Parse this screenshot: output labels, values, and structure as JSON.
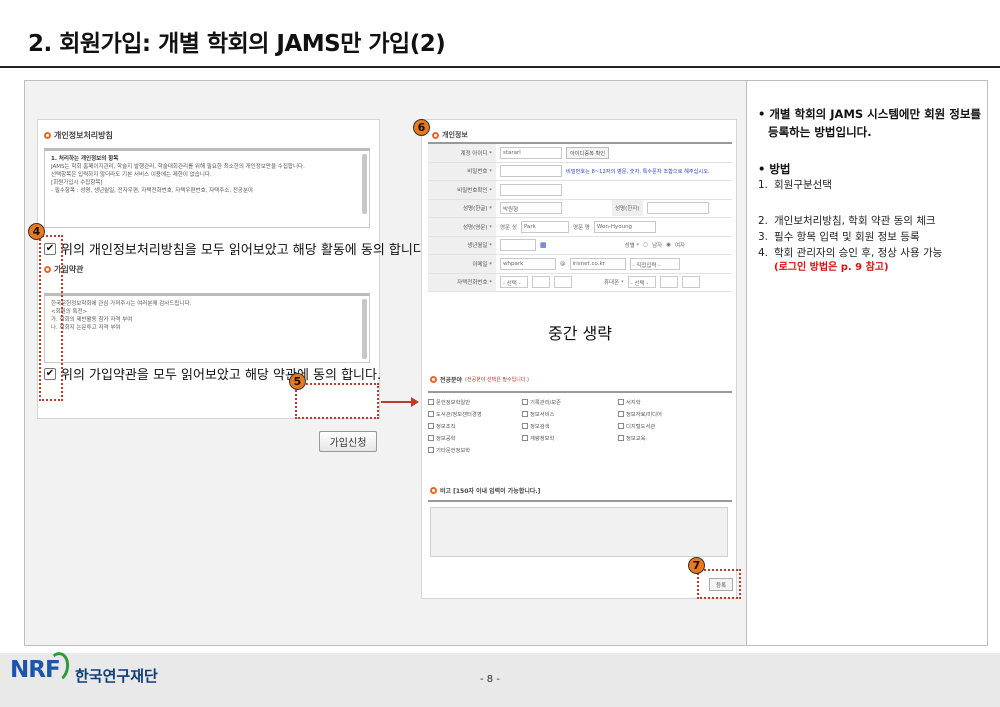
{
  "slide": {
    "title": "2. 회원가입: 개별 학회의 JAMS만 가입(2)",
    "page_number": "- 8 -"
  },
  "left_panel": {
    "privacy_heading": "개인정보처리방침",
    "privacy_text": [
      "1. 처리하는 개인정보의 항목",
      "JAMS는 학회 홈페이지관리, 학술지 발행관리, 학술대회관리를 위해 필요한 최소한의 개인정보만을 수집합니다.",
      "선택항목은 입력하지 않더라도 기본 서비스 이용에는 제한이 없습니다.",
      "",
      "[회원가입시 수집항목]",
      "- 필수항목 : 성명, 생년월일, 전자우편, 자택전화번호, 자택우편번호, 자택주소, 전공분야"
    ],
    "privacy_agree": "위의 개인정보처리방침을 모두 읽어보았고 해당 활동에 동의 합니다.",
    "terms_heading": "가입약관",
    "terms_text": [
      "한국문헌정보학회에 관심 가져주시는 여러분께 감사드립니다.",
      "",
      "<회원의 특전>",
      "가. 학회의 제반활동 참가 자격 부여",
      "나. 학회지 논문투고 자격 부여"
    ],
    "terms_agree": "위의 가입약관을 모두 읽어보았고 해당 약관에 동의 합니다.",
    "join_button": "가입신청"
  },
  "badges": {
    "b4": "4",
    "b5": "5",
    "b6": "6",
    "b7": "7"
  },
  "form": {
    "heading": "개인정보",
    "rows": {
      "account_id_label": "계정 아이디 *",
      "account_id_value": "stararl",
      "id_check_button": "아이디중복 확인",
      "password_label": "비밀번호 *",
      "password_note": "비밀번호는 8~12자의 영문, 숫자, 특수문자 조합으로 해주십시오.",
      "password_confirm_label": "비밀번호확인 *",
      "name_ko_label": "성명(한글) *",
      "name_ko_value": "박원형",
      "name_hanja_label": "성명(한자)",
      "name_en_label": "성명(영문) *",
      "name_en_last_label": "영문 성",
      "name_en_last_value": "Park",
      "name_en_first_label": "영문 명",
      "name_en_first_value": "Won-Hyoung",
      "birth_label": "생년월일 *",
      "gender_label": "성별 *",
      "gender_male": "남자",
      "gender_female": "여자",
      "email_label": "이메일 *",
      "email_id": "whpark",
      "email_at": "@",
      "email_domain": "irisnet.co.kr",
      "email_select": "- 직접입력 -",
      "home_phone_label": "자택전화번호 *",
      "home_phone_select": "- 선택 -",
      "mobile_label": "휴대폰 *",
      "mobile_select": "- 선택 -"
    },
    "omitted_text": "중간 생략",
    "field_heading": "전공분야",
    "field_sub": "(전공분야 선택은 필수입니다.)",
    "fields": [
      "문헌정보학일반",
      "기록관리/보존",
      "서지학",
      "도서관/정보센터경영",
      "정보서비스",
      "정보자료/미디어",
      "정보조직",
      "정보검색",
      "디지털도서관",
      "정보공학",
      "계량정보학",
      "정보교육",
      "기타문헌정보학"
    ],
    "memo_heading": "비고 [150자 이내 입력이 가능합니다.]",
    "register_button": "등록"
  },
  "description": {
    "intro": "• 개별 학회의 JAMS 시스템에만 회원 정보를 등록하는 방법입니다.",
    "method_heading": "• 방법",
    "steps": [
      {
        "num": "1.",
        "text": "회원구분선택"
      },
      {
        "num": "2.",
        "text": "개인보처리방침, 학회 약관 동의 체크"
      },
      {
        "num": "3.",
        "text": "필수 항목 입력 및 회원 정보 등록"
      },
      {
        "num": "4.",
        "text": "학회 관리자의 승인 후, 정상 사용 가능"
      }
    ],
    "login_note": "(로그인 방법은 p. 9 참고)"
  },
  "footer": {
    "logo_text": "NRF",
    "org_name": "한국연구재단"
  },
  "colors": {
    "accent_orange": "#e9781e",
    "dash_red": "#c0392b",
    "note_red": "#e01010",
    "note_blue": "#2a45c6",
    "logo_blue": "#1c56a8",
    "logo_green": "#2e9b3a"
  }
}
